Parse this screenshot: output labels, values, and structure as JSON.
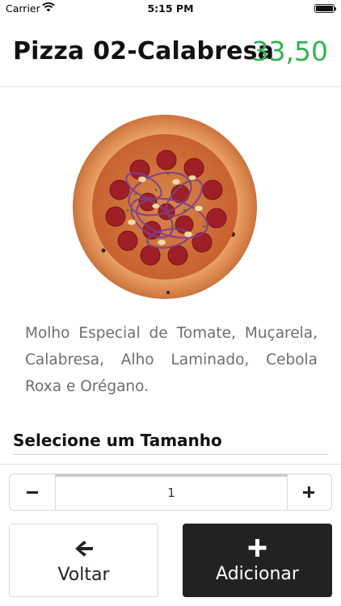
{
  "status_bar": {
    "carrier": "Carrier",
    "time": "5:15 PM"
  },
  "product": {
    "title": "Pizza 02-Calabresa",
    "price": "33,50",
    "price_color": "#2fb550",
    "description": "Molho Especial de Tomate, Muçarela, Calabresa, Alho Laminado, Cebola Roxa e Orégano."
  },
  "size_section": {
    "title": "Selecione um Tamanho"
  },
  "quantity": {
    "value": "1",
    "decrement_icon": "minus-icon",
    "increment_icon": "plus-icon"
  },
  "actions": {
    "back_label": "Voltar",
    "back_icon": "arrow-left-icon",
    "add_label": "Adicionar",
    "add_icon": "plus-icon",
    "add_background": "#222222"
  }
}
